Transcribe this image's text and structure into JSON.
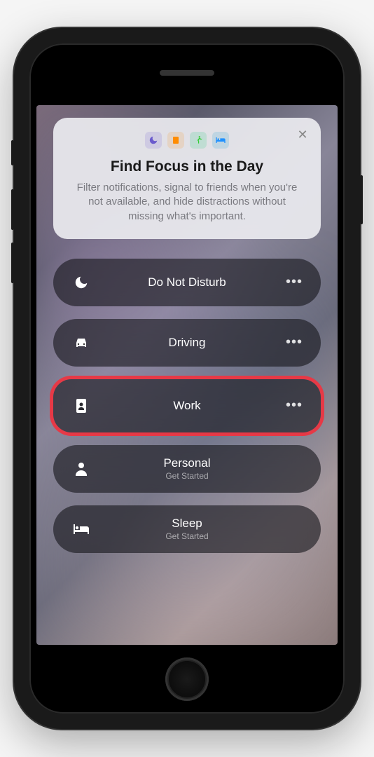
{
  "info_card": {
    "title": "Find Focus in the Day",
    "subtitle": "Filter notifications, signal to friends when you're not available, and hide distractions without missing what's important.",
    "icons": [
      "moon",
      "book",
      "running",
      "bed"
    ]
  },
  "focus_items": [
    {
      "icon": "moon",
      "label": "Do Not Disturb",
      "sub": "",
      "has_more": true,
      "highlighted": false
    },
    {
      "icon": "car",
      "label": "Driving",
      "sub": "",
      "has_more": true,
      "highlighted": false
    },
    {
      "icon": "badge",
      "label": "Work",
      "sub": "",
      "has_more": true,
      "highlighted": true
    },
    {
      "icon": "person",
      "label": "Personal",
      "sub": "Get Started",
      "has_more": false,
      "highlighted": false
    },
    {
      "icon": "bed",
      "label": "Sleep",
      "sub": "Get Started",
      "has_more": false,
      "highlighted": false
    }
  ],
  "more_glyph": "•••",
  "close_glyph": "✕"
}
